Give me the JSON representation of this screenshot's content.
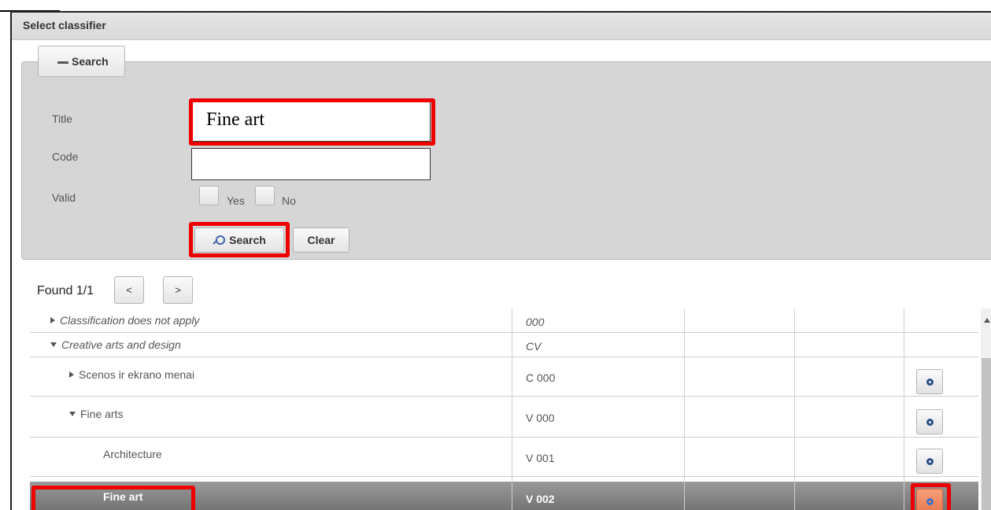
{
  "dialog": {
    "title": "Select classifier"
  },
  "search_panel": {
    "toggle_label": "Search",
    "fields": {
      "title_label": "Title",
      "title_value": "Fine art",
      "code_label": "Code",
      "code_value": "",
      "valid_label": "Valid",
      "yes_label": "Yes",
      "no_label": "No"
    },
    "search_button": "Search",
    "clear_button": "Clear"
  },
  "pagination": {
    "found_text": "Found 1/1",
    "prev_label": "<",
    "next_label": ">"
  },
  "rows": [
    {
      "title": "Classification does not apply",
      "code": "000",
      "expander": "collapsed",
      "italic": true,
      "has_action": false
    },
    {
      "title": "Creative arts and design",
      "code": "CV",
      "expander": "expanded",
      "italic": true,
      "has_action": false
    },
    {
      "title": "Scenos ir ekrano menai",
      "code": "C 000",
      "expander": "collapsed",
      "italic": false,
      "has_action": true
    },
    {
      "title": "Fine arts",
      "code": "V 000",
      "expander": "expanded",
      "italic": false,
      "has_action": true
    },
    {
      "title": "Architecture",
      "code": "V 001",
      "expander": "none",
      "italic": false,
      "has_action": true
    },
    {
      "title": "Fine art",
      "code": "V 002",
      "expander": "none",
      "italic": false,
      "has_action": true,
      "selected": true
    }
  ],
  "icons": {
    "legend": "minus-icon",
    "search": "search-icon",
    "row_action": "select-circle-icon"
  },
  "colors": {
    "highlight": "#ee0000",
    "selected_row": "#808080",
    "active_action": "#e8764c"
  }
}
